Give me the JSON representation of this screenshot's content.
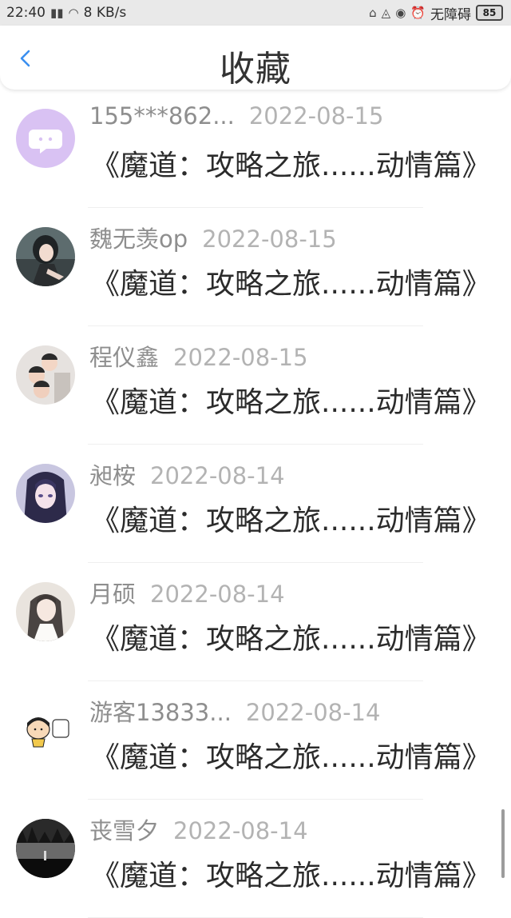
{
  "status_bar": {
    "time": "22:40",
    "speed": "8 KB/s",
    "accessibility": "无障碍",
    "battery": "85"
  },
  "header": {
    "title": "收藏"
  },
  "items": [
    {
      "username": "155***862...",
      "date": "2022-08-15",
      "title": "《魔道：攻略之旅......动情篇》",
      "avatar": "chat-bubble-icon"
    },
    {
      "username": "魏无羡op",
      "date": "2022-08-15",
      "title": "《魔道：攻略之旅......动情篇》",
      "avatar": "anime-portrait-dark"
    },
    {
      "username": "程仪鑫",
      "date": "2022-08-15",
      "title": "《魔道：攻略之旅......动情篇》",
      "avatar": "photo-kids"
    },
    {
      "username": "昶桉",
      "date": "2022-08-14",
      "title": "《魔道：攻略之旅......动情篇》",
      "avatar": "anime-portrait-purple"
    },
    {
      "username": "月硕",
      "date": "2022-08-14",
      "title": "《魔道：攻略之旅......动情篇》",
      "avatar": "anime-portrait-light"
    },
    {
      "username": "游客13833...",
      "date": "2022-08-14",
      "title": "《魔道：攻略之旅......动情篇》",
      "avatar": "cartoon-character"
    },
    {
      "username": "丧雪夕",
      "date": "2022-08-14",
      "title": "《魔道：攻略之旅......动情篇》",
      "avatar": "dark-forest"
    }
  ]
}
